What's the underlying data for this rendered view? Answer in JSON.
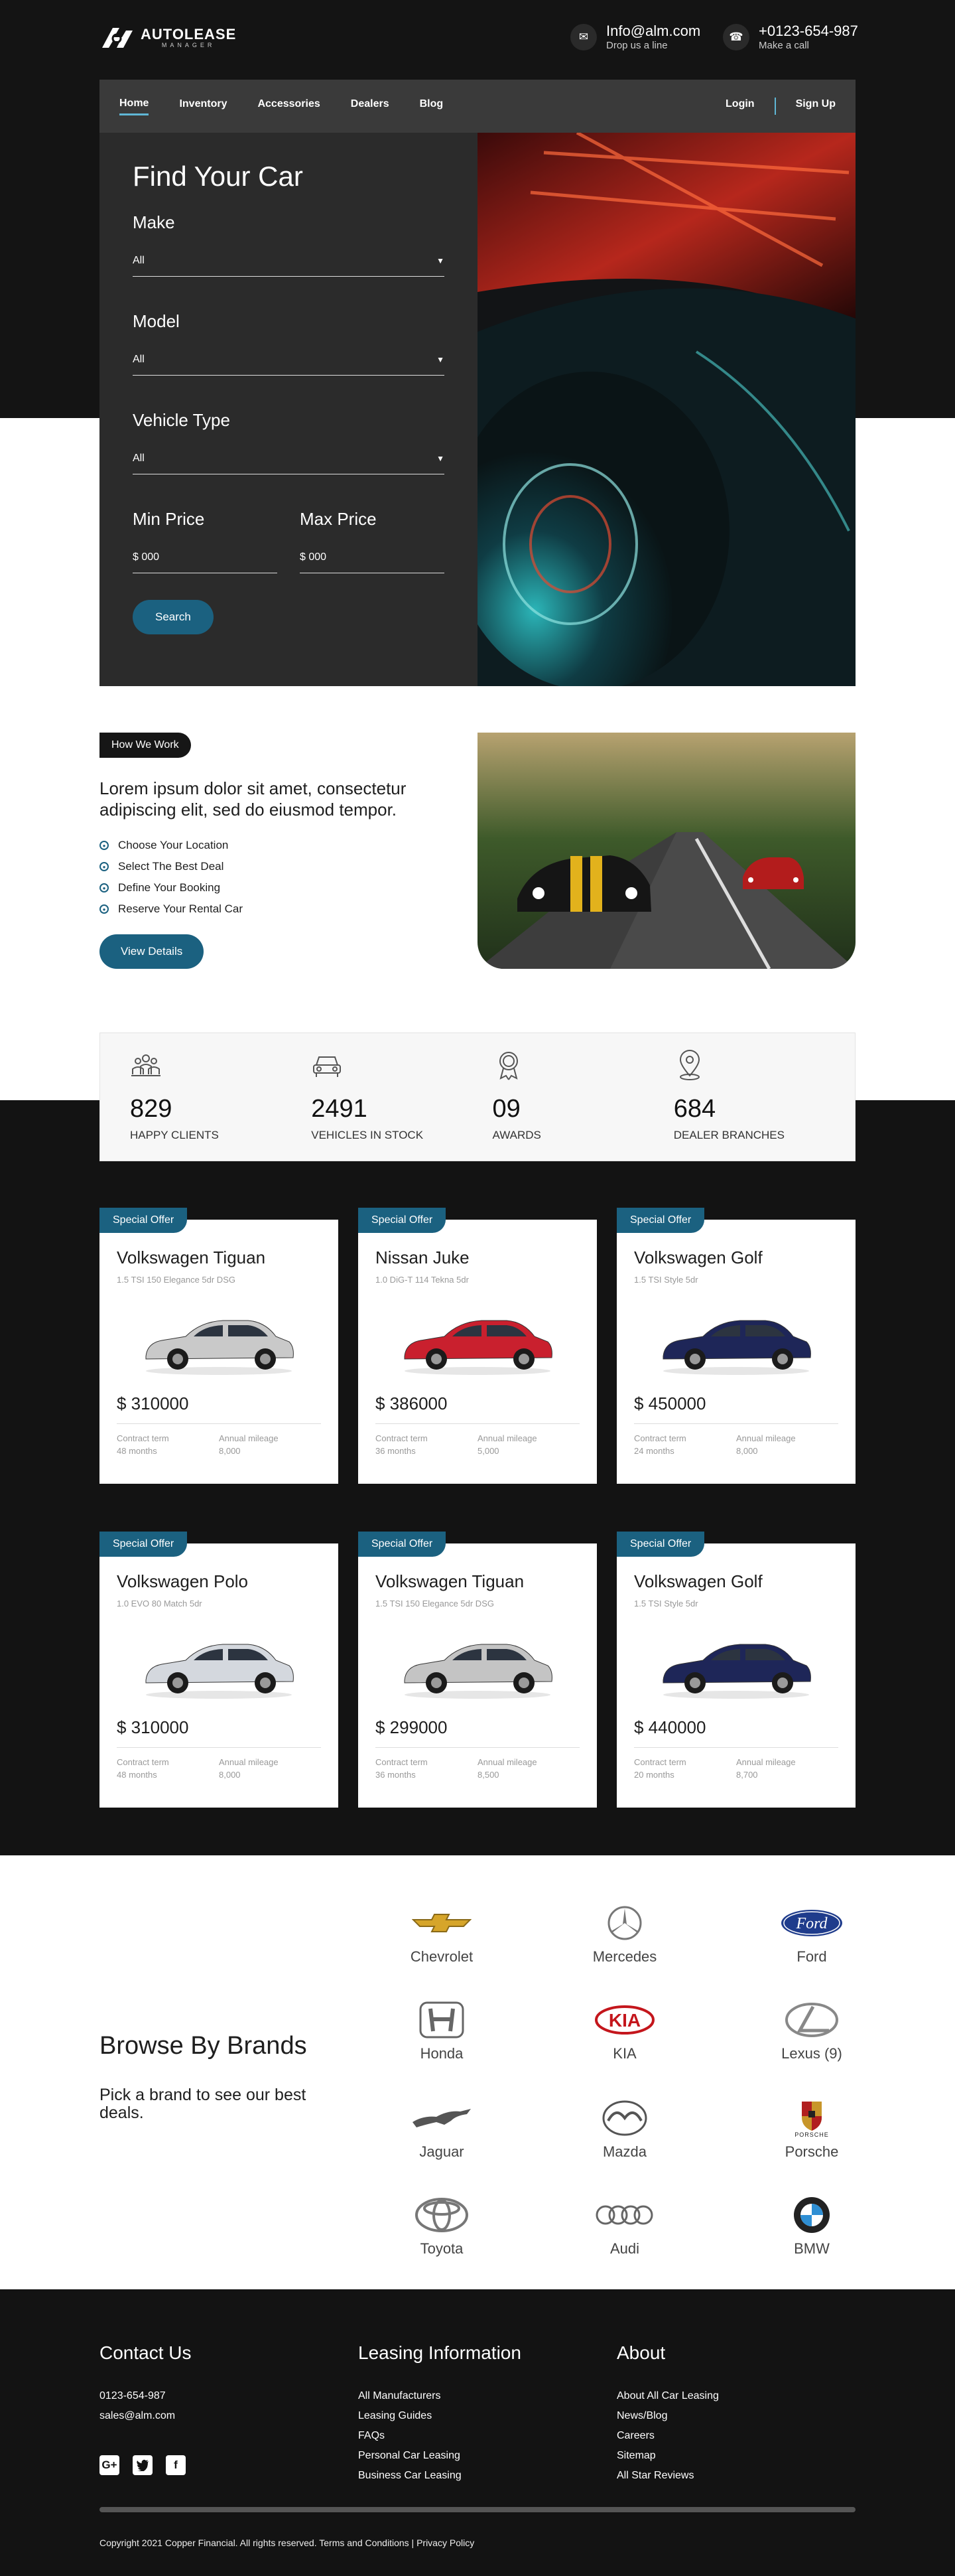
{
  "header": {
    "brand": "AUTOLEASE",
    "brand_sub": "MANAGER",
    "email": "Info@alm.com",
    "email_sub": "Drop us a line",
    "phone": "+0123-654-987",
    "phone_sub": "Make a call"
  },
  "nav": {
    "items": [
      "Home",
      "Inventory",
      "Accessories",
      "Dealers",
      "Blog"
    ],
    "login": "Login",
    "signup": "Sign Up"
  },
  "finder": {
    "title": "Find Your Car",
    "make_label": "Make",
    "make_value": "All",
    "model_label": "Model",
    "model_value": "All",
    "type_label": "Vehicle Type",
    "type_value": "All",
    "min_label": "Min Price",
    "min_value": "$ 000",
    "max_label": "Max Price",
    "max_value": "$ 000",
    "search": "Search"
  },
  "how": {
    "tag": "How We Work",
    "text": "Lorem ipsum dolor sit amet, consectetur adipiscing elit, sed do eiusmod tempor.",
    "steps": [
      "Choose Your Location",
      "Select The Best Deal",
      "Define Your Booking",
      "Reserve Your Rental Car"
    ],
    "button": "View Details"
  },
  "stats": [
    {
      "num": "829",
      "label": "HAPPY CLIENTS"
    },
    {
      "num": "2491",
      "label": "VEHICLES IN STOCK"
    },
    {
      "num": "09",
      "label": "AWARDS"
    },
    {
      "num": "684",
      "label": "DEALER BRANCHES"
    }
  ],
  "offers": {
    "badge": "Special Offer",
    "term_label": "Contract term",
    "mileage_label": "Annual mileage",
    "cars": [
      {
        "name": "Volkswagen Tiguan",
        "sub": "1.5 TSI 150 Elegance 5dr DSG",
        "price": "$ 310000",
        "term": "48 months",
        "mileage": "8,000",
        "color": "#c9c9c9"
      },
      {
        "name": "Nissan Juke",
        "sub": "1.0 DiG-T 114 Tekna 5dr",
        "price": "$ 386000",
        "term": "36 months",
        "mileage": "5,000",
        "color": "#c9202e"
      },
      {
        "name": "Volkswagen Golf",
        "sub": "1.5 TSI Style 5dr",
        "price": "$ 450000",
        "term": "24 months",
        "mileage": "8,000",
        "color": "#1e2658"
      },
      {
        "name": "Volkswagen Polo",
        "sub": "1.0 EVO 80 Match 5dr",
        "price": "$ 310000",
        "term": "48 months",
        "mileage": "8,000",
        "color": "#d4d8de"
      },
      {
        "name": "Volkswagen Tiguan",
        "sub": "1.5 TSI 150 Elegance 5dr DSG",
        "price": "$ 299000",
        "term": "36 months",
        "mileage": "8,500",
        "color": "#c4c4c4"
      },
      {
        "name": "Volkswagen Golf",
        "sub": "1.5 TSI Style 5dr",
        "price": "$ 440000",
        "term": "20 months",
        "mileage": "8,700",
        "color": "#1e2658"
      }
    ]
  },
  "brands": {
    "title": "Browse By Brands",
    "sub": "Pick a brand to see our best deals.",
    "items": [
      "Chevrolet",
      "Mercedes",
      "Ford",
      "Honda",
      "KIA",
      "Lexus (9)",
      "Jaguar",
      "Mazda",
      "Porsche",
      "Toyota",
      "Audi",
      "BMW"
    ]
  },
  "footer": {
    "contact_title": "Contact Us",
    "phone": "0123-654-987",
    "email": "sales@alm.com",
    "leasing_title": "Leasing Information",
    "leasing_links": [
      "All Manufacturers",
      "Leasing Guides",
      "FAQs",
      "Personal Car Leasing",
      "Business Car Leasing"
    ],
    "about_title": "About",
    "about_links": [
      "About All Car Leasing",
      "News/Blog",
      "Careers",
      "Sitemap",
      "All Star Reviews"
    ],
    "copyright": "Copyright 2021 Copper Financial. All rights reserved. Terms and Conditions | Privacy Policy"
  }
}
